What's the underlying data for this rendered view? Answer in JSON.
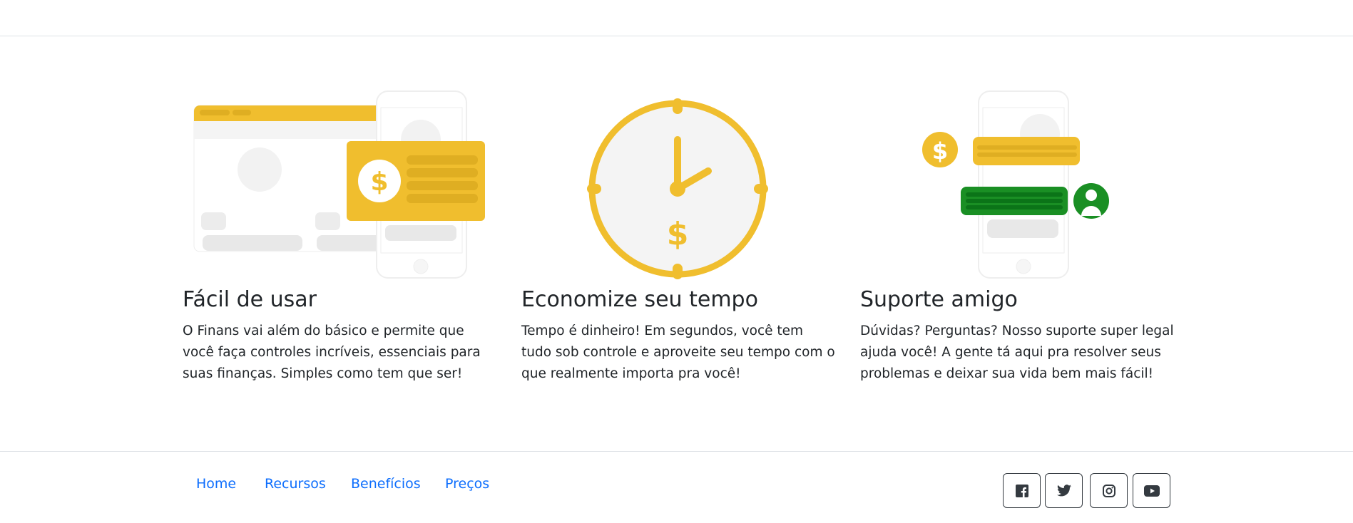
{
  "features": [
    {
      "title": "Fácil de usar",
      "text": "O Finans vai além do básico e permite que você faça controles incríveis, essenciais para suas finanças. Simples como tem que ser!",
      "illustration": "dashboard-phone-money-card"
    },
    {
      "title": "Economize seu tempo",
      "text": "Tempo é dinheiro! Em segundos, você tem tudo sob controle e aproveite seu tempo com o que realmente importa pra você!",
      "illustration": "clock-dollar"
    },
    {
      "title": "Suporte amigo",
      "text": "Dúvidas? Perguntas? Nosso suporte super legal ajuda você! A gente tá aqui pra resolver seus problemas e deixar sua vida bem mais fácil!",
      "illustration": "phone-chat-support"
    }
  ],
  "footer": {
    "links": [
      "Home",
      "Recursos",
      "Benefícios",
      "Preços"
    ],
    "social": [
      "facebook-icon",
      "twitter-icon",
      "instagram-icon",
      "youtube-icon"
    ]
  },
  "colors": {
    "accent_yellow": "#f0be2e",
    "support_green": "#1a8f24",
    "link": "#0d6efd",
    "text": "#212529"
  }
}
